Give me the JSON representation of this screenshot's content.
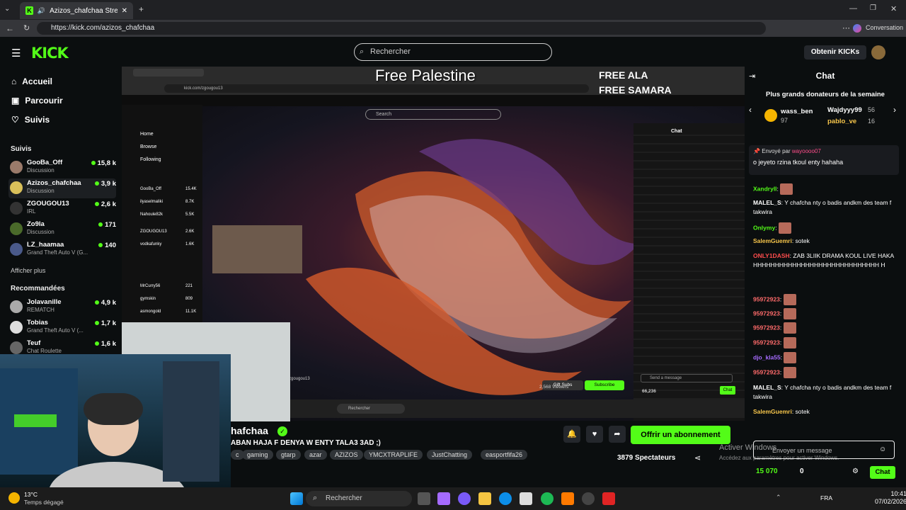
{
  "browser": {
    "tab_title": "Azizos_chafchaa Stream - Wa",
    "url": "https://kick.com/azizos_chafchaa",
    "conversation_label": "Conversation"
  },
  "header": {
    "logo": "KICK",
    "search_placeholder": "Rechercher",
    "get_kicks": "Obtenir KICKs"
  },
  "sidebar": {
    "nav": [
      {
        "label": "Accueil",
        "icon": "home-icon"
      },
      {
        "label": "Parcourir",
        "icon": "browse-icon"
      },
      {
        "label": "Suivis",
        "icon": "heart-icon"
      }
    ],
    "following_title": "Suivis",
    "following": [
      {
        "name": "GooBa_Off",
        "category": "Discussion",
        "viewers": "15,8 k"
      },
      {
        "name": "Azizos_chafchaa",
        "category": "Discussion",
        "viewers": "3,9 k"
      },
      {
        "name": "ZGOUGOU13",
        "category": "IRL",
        "viewers": "2,6 k"
      },
      {
        "name": "Zo9la",
        "category": "Discussion",
        "viewers": "171"
      },
      {
        "name": "LZ_haamaa",
        "category": "Grand Theft Auto V (G...",
        "viewers": "140"
      }
    ],
    "show_more": "Afficher plus",
    "recommended_title": "Recommandées",
    "recommended": [
      {
        "name": "Jolavanille",
        "category": "REMATCH",
        "viewers": "4,9 k"
      },
      {
        "name": "Tobias",
        "category": "Grand Theft Auto V (...",
        "viewers": "1,7 k"
      },
      {
        "name": "Teuf",
        "category": "Chat Roulette",
        "viewers": "1,6 k"
      }
    ]
  },
  "video": {
    "free_palestine": "Free Palestine",
    "free_ala": "FREE ALA",
    "free_samara": "FREE SAMARA",
    "inner_url": "kick.com/zgougou13",
    "inner_search": "Search",
    "inner_chat_title": "Chat",
    "inner_nav": [
      "Home",
      "Browse",
      "Following"
    ],
    "inner_following": [
      {
        "name": "GooBa_Off",
        "viewers": "15.4K"
      },
      {
        "name": "ilyaselmaliki",
        "viewers": "8.7K"
      },
      {
        "name": "Nahoule82k",
        "viewers": "5.5K"
      },
      {
        "name": "ZGOUGOU13",
        "viewers": "2.6K"
      },
      {
        "name": "vodkafunky",
        "viewers": "1.6K"
      }
    ],
    "inner_recommended": [
      {
        "name": "MrCurry56",
        "viewers": "221"
      },
      {
        "name": "gymskin",
        "viewers": "809"
      },
      {
        "name": "asmongold",
        "viewers": "11.1K"
      }
    ],
    "inner_viewers": "2,568 Viewers",
    "inner_gift": "Gift Subs",
    "inner_subscribe": "Subscribe",
    "inner_taskbar_search": "Rechercher",
    "inner_send": "Send a message",
    "inner_count": "66,236",
    "inner_chat_btn": "Chat",
    "inner_streamer": "zgougou13"
  },
  "stream": {
    "channel": "hafchaa",
    "title": "ABAN HAJA F DENYA W ENTY TALA3 3AD ;)",
    "tags": [
      "c",
      "gaming",
      "gtarp",
      "azar",
      "AZIZOS",
      "YMCXTRAPLIFE",
      "JustChatting",
      "easportfifa26"
    ],
    "subscribe": "Offrir un abonnement",
    "viewers": "3879 Spectateurs"
  },
  "chat": {
    "title": "Chat",
    "donors_title": "Plus grands donateurs de la semaine",
    "donors": [
      {
        "name": "wass_ben",
        "amount": "97"
      },
      {
        "name": "Wajdyyy99",
        "amount": "56"
      },
      {
        "name": "pablo_ve",
        "amount": "16"
      }
    ],
    "pinned_by_label": "Envoyé par",
    "pinned_by": "wayoooo07",
    "pinned_text": "o jeyeto rzina tkoul enty hahaha",
    "messages": [
      {
        "user": "Xandryll",
        "text": "",
        "color": "#53fc18"
      },
      {
        "user": "MALEL_S",
        "text": "Y chafcha nty o badis andkm des team f takwira",
        "color": "#ffffff"
      },
      {
        "user": "Onlymy",
        "text": "",
        "color": "#53fc18"
      },
      {
        "user": "SalemGuemri",
        "text": "sotek",
        "color": "#f7c64b"
      },
      {
        "user": "ONLY1DASH",
        "text": "ZAB 3LIIK DRAMA KOUL LIVE HAKA HHHHHHHHHHHHHHHHHHHHHHHHHHHHH H",
        "color": "#ff4d4d"
      },
      {
        "user": "95972923",
        "text": "",
        "color": "#ff6b6b"
      },
      {
        "user": "95972923",
        "text": "",
        "color": "#ff6b6b"
      },
      {
        "user": "95972923",
        "text": "",
        "color": "#ff6b6b"
      },
      {
        "user": "95972923",
        "text": "",
        "color": "#ff6b6b"
      },
      {
        "user": "djo_kla55",
        "text": "",
        "color": "#a66bff"
      },
      {
        "user": "95972923",
        "text": "",
        "color": "#ff6b6b"
      },
      {
        "user": "MALEL_S",
        "text": "Y chafcha nty o badis andkm des team f takwira",
        "color": "#ffffff"
      },
      {
        "user": "SalemGuemri",
        "text": "sotek",
        "color": "#f7c64b"
      }
    ],
    "input_placeholder": "Envoyer un message",
    "kicks_count": "15 070",
    "bag_count": "0",
    "chat_button": "Chat"
  },
  "windows": {
    "activate_title": "Activer Windows",
    "activate_sub": "Accédez aux paramètres pour activer Windows.",
    "weather_temp": "13°C",
    "weather_desc": "Temps dégagé",
    "search": "Rechercher",
    "lang": "FRA",
    "time": "10:41",
    "date": "07/02/2026"
  },
  "colors": {
    "brand": "#53fc18",
    "bg": "#0b0e0f",
    "panel": "#24272c"
  }
}
